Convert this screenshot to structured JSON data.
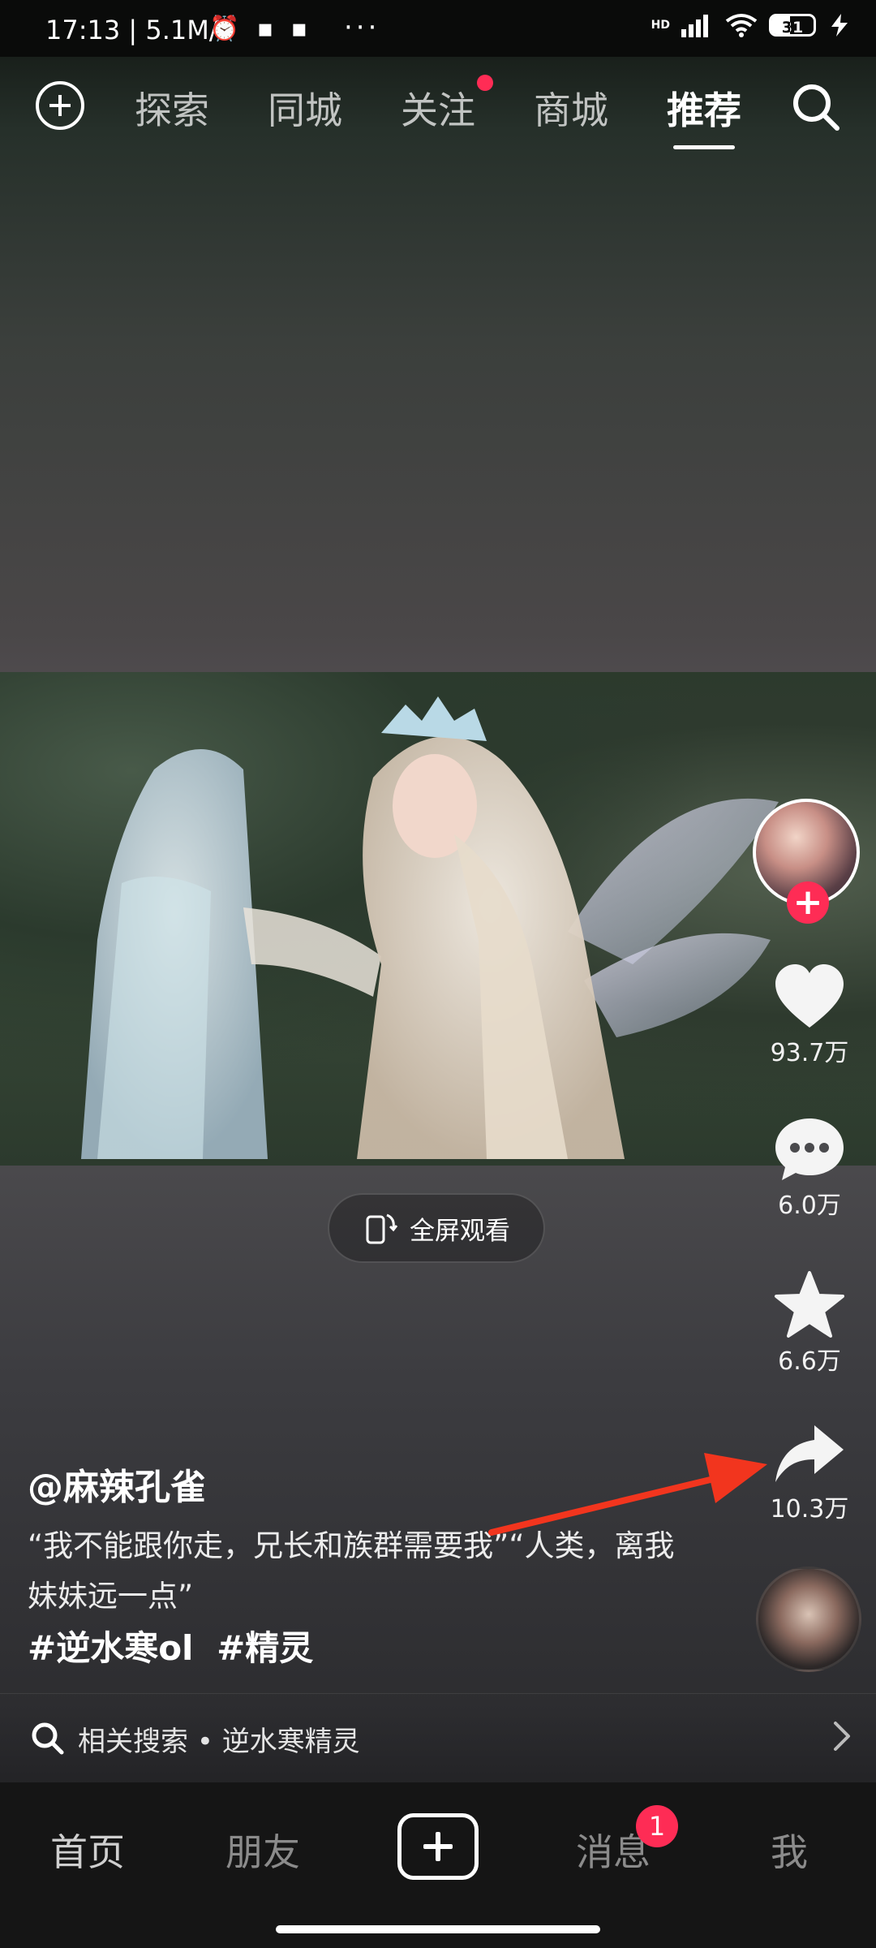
{
  "status_bar": {
    "time": "17:13",
    "speed": "5.1M/s",
    "network": "HD",
    "battery": "31"
  },
  "top_nav": {
    "tabs": [
      "探索",
      "同城",
      "关注",
      "商城",
      "推荐"
    ],
    "active_tab": "推荐",
    "follow_has_new": true
  },
  "video": {
    "fullscreen_label": "全屏观看"
  },
  "actions": {
    "likes": "93.7万",
    "comments": "6.0万",
    "favorites": "6.6万",
    "shares": "10.3万"
  },
  "caption": {
    "author": "@麻辣孔雀",
    "description": "“我不能跟你走，兄长和族群需要我”“人类，离我妹妹远一点”",
    "tags": [
      "#逆水寒ol",
      "#精灵"
    ]
  },
  "related_search": {
    "label": "相关搜索",
    "separator": "•",
    "query": "逆水寒精灵"
  },
  "bottom_nav": {
    "home": "首页",
    "friends": "朋友",
    "messages": "消息",
    "messages_badge": "1",
    "me": "我"
  },
  "colors": {
    "accent": "#fe2c55",
    "annotation_arrow": "#f2351e"
  }
}
